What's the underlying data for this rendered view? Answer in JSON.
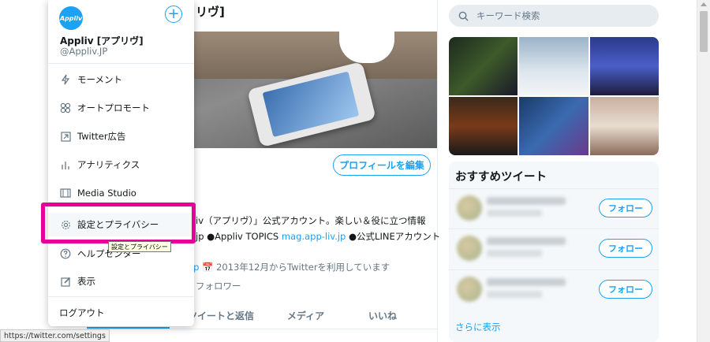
{
  "profile": {
    "title_fragment": "リヴ]",
    "edit_profile_label": "プロフィールを編集",
    "bio_line1": "iv（アプリヴ）」公式アカウント。楽しい＆役に立つ情報",
    "bio_line2_prefix": "jp ●Appliv TOPICS ",
    "bio_line2_link": "mag.app-liv.jp",
    "bio_line2_suffix": " ●公式LINEアカウント",
    "bio_line3_link": "liv.jp",
    "bio_line3_text": " 📅 2013年12月からTwitterを利用しています",
    "followers_label": "フォロワー"
  },
  "tabs": [
    {
      "label": ""
    },
    {
      "label": "ツイートと返信"
    },
    {
      "label": "メディア"
    },
    {
      "label": "いいね"
    }
  ],
  "search": {
    "placeholder": "キーワード検索"
  },
  "recommend": {
    "title": "おすすめツイート",
    "follow_label": "フォロー",
    "more_label": "さらに表示"
  },
  "menu": {
    "logo_text": "Appliv",
    "account_name": "Appliv [アプリヴ]",
    "account_handle": "@Appliv.JP",
    "items": [
      {
        "label": "モーメント",
        "icon": "lightning-icon"
      },
      {
        "label": "オートプロモート",
        "icon": "autopromote-icon"
      },
      {
        "label": "Twitter広告",
        "icon": "ads-arrow-icon"
      },
      {
        "label": "アナリティクス",
        "icon": "analytics-icon"
      },
      {
        "label": "Media Studio",
        "icon": "film-icon"
      },
      {
        "label": "設定とプライバシー",
        "icon": "gear-icon"
      },
      {
        "label": "ヘルプセンター",
        "icon": "help-icon"
      },
      {
        "label": "表示",
        "icon": "edit-icon"
      }
    ],
    "logout_label": "ログアウト"
  },
  "tooltip_text": "設定とプライバシー",
  "status_url": "https://twitter.com/settings",
  "colors": {
    "accent": "#1da1f2",
    "highlight": "#e6009a"
  }
}
